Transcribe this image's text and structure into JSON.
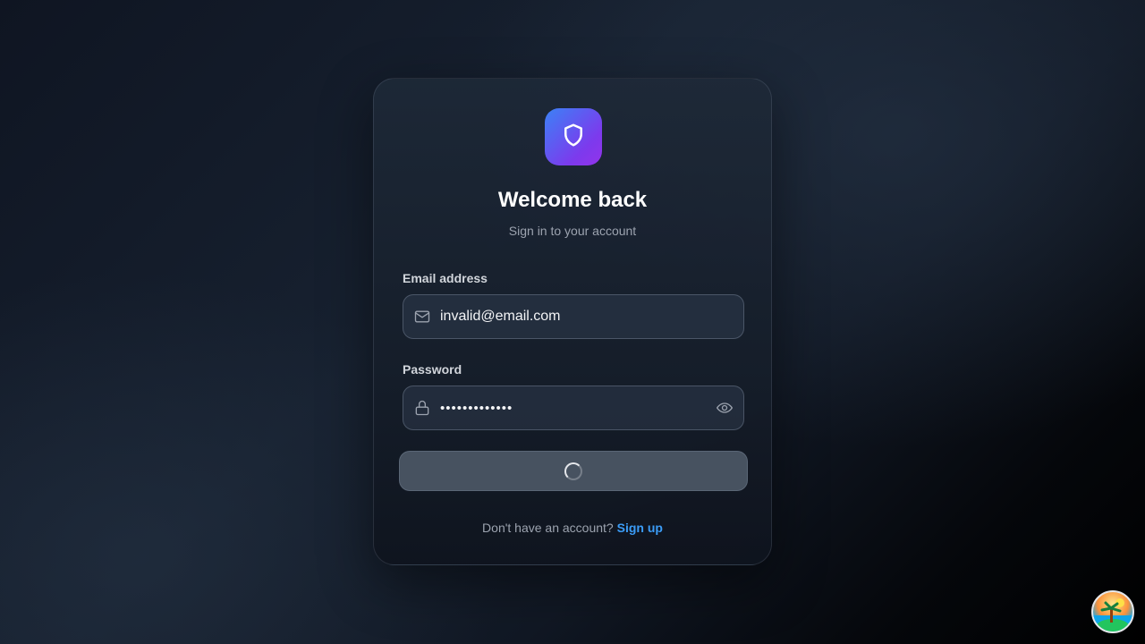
{
  "login": {
    "title": "Welcome back",
    "subtitle": "Sign in to your account",
    "email_label": "Email address",
    "email_value": "invalid@email.com",
    "password_label": "Password",
    "password_value": "•••••••••••••",
    "submit_state": "loading",
    "footer_text": "Don't have an account?",
    "signup_link": "Sign up"
  },
  "icons": {
    "logo": "shield-icon",
    "email": "mail-icon",
    "password": "lock-icon",
    "toggle": "eye-icon",
    "avatar": "tropical-island-avatar"
  },
  "colors": {
    "accent_link": "#3b9cf6",
    "logo_gradient_start": "#3b82f6",
    "logo_gradient_end": "#9333ea"
  }
}
